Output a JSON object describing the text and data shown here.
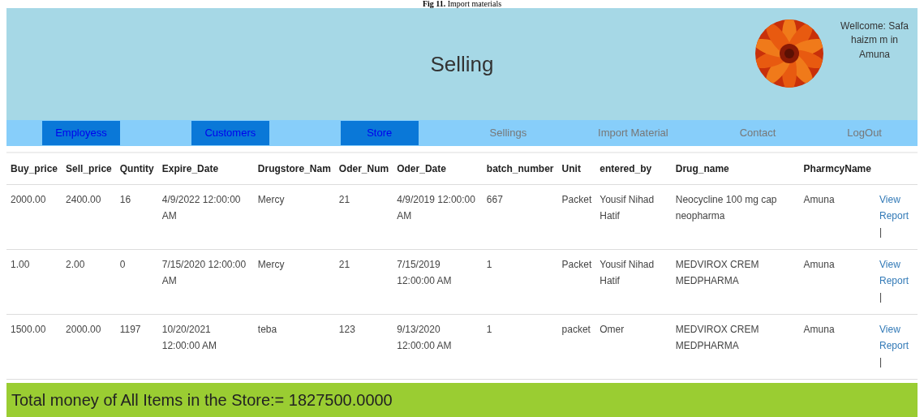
{
  "caption": "**Fig 11.** Import materials",
  "header": {
    "title": "Selling",
    "welcome": "Wellcome: Safa haizm m in Amuna"
  },
  "nav": [
    {
      "label": "Employess",
      "kind": "button"
    },
    {
      "label": "Customers",
      "kind": "button"
    },
    {
      "label": "Store",
      "kind": "button"
    },
    {
      "label": "Sellings",
      "kind": "link"
    },
    {
      "label": "Import Material",
      "kind": "link"
    },
    {
      "label": "Contact",
      "kind": "link"
    },
    {
      "label": "LogOut",
      "kind": "link"
    }
  ],
  "table": {
    "columns": [
      "Buy_price",
      "Sell_price",
      "Quntity",
      "Expire_Date",
      "Drugstore_Nam",
      "Oder_Num",
      "Oder_Date",
      "batch_number",
      "Unit",
      "entered_by",
      "Drug_name",
      "PharmcyName"
    ],
    "rows": [
      {
        "cells": [
          "2000.00",
          "2400.00",
          "16",
          "4/9/2022 12:00:00 AM",
          "Mercy",
          "21",
          "4/9/2019 12:00:00 AM",
          "667",
          "Packet",
          "Yousif Nihad Hatif",
          "Neocycline 100 mg cap neopharma",
          "Amuna"
        ],
        "link": "View Report",
        "separator": "|"
      },
      {
        "cells": [
          "1.00",
          "2.00",
          "0",
          "7/15/2020 12:00:00 AM",
          "Mercy",
          "21",
          "7/15/2019 12:00:00 AM",
          "1",
          "Packet",
          "Yousif Nihad Hatif",
          "MEDVIROX CREM MEDPHARMA",
          "Amuna"
        ],
        "link": "View Report",
        "separator": "|"
      },
      {
        "cells": [
          "1500.00",
          "2000.00",
          "1197",
          "10/20/2021 12:00:00 AM",
          "teba",
          "123",
          "9/13/2020 12:00:00 AM",
          "1",
          "packet",
          "Omer",
          "MEDVIROX CREM MEDPHARMA",
          "Amuna"
        ],
        "link": "View Report",
        "separator": "|"
      }
    ]
  },
  "total": "Total money of All Items in the Store:= 1827500.0000"
}
